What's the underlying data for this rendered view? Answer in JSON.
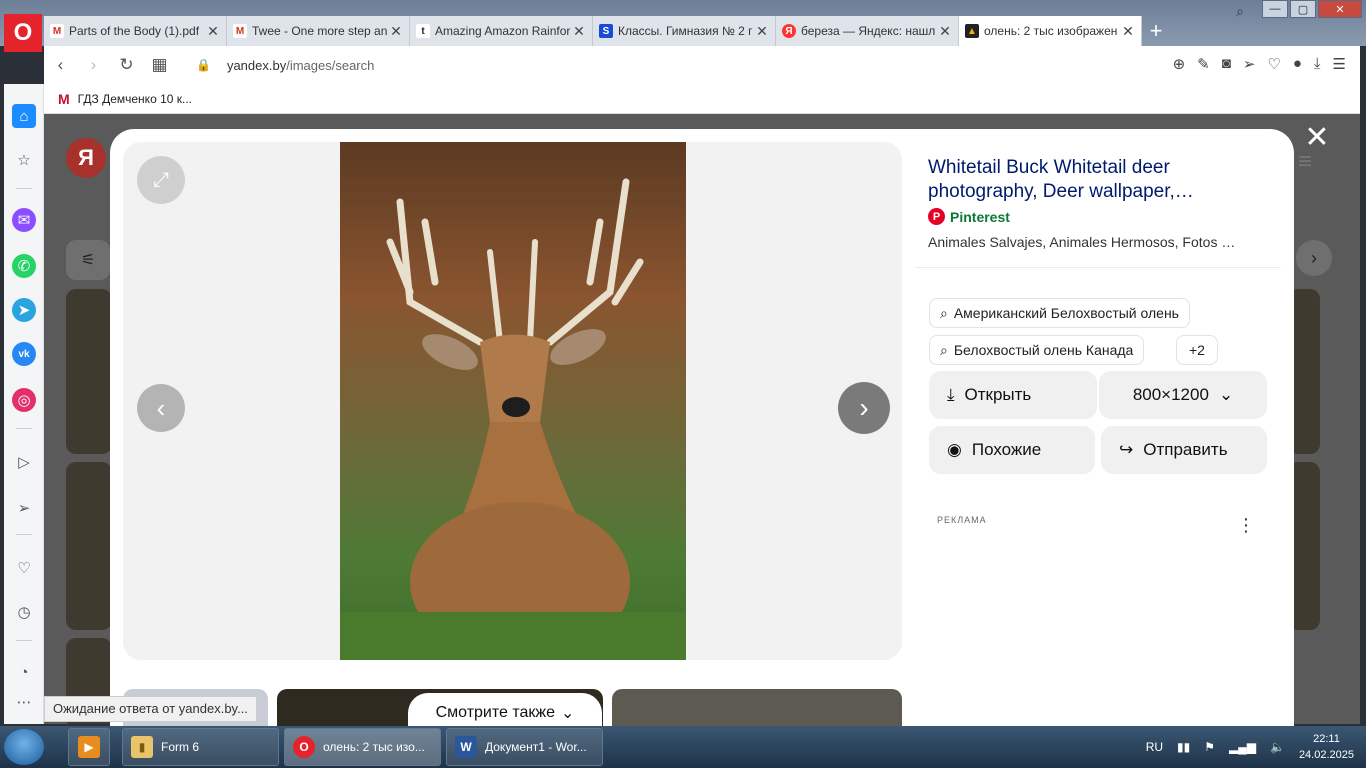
{
  "browser": {
    "tabs": [
      {
        "title": "Parts of the Body (1).pdf",
        "icon": "gmail-icon",
        "color": "#d93025",
        "glyph": "M"
      },
      {
        "title": "Twee - One more step an",
        "icon": "gmail-icon",
        "color": "#d93025",
        "glyph": "M"
      },
      {
        "title": "Amazing Amazon Rainfor",
        "icon": "tumblr-icon",
        "color": "#222222",
        "glyph": "t"
      },
      {
        "title": "Классы. Гимназия № 2 г",
        "icon": "s-icon",
        "color": "#1a4bd6",
        "glyph": "S"
      },
      {
        "title": "береза — Яндекс: нашл",
        "icon": "yandex-icon",
        "color": "#f33",
        "glyph": "Я"
      },
      {
        "title": "олень: 2 тыс изображен",
        "icon": "yandex-images-icon",
        "color": "#f4b400",
        "glyph": "▲"
      }
    ],
    "url_domain": "yandex.by",
    "url_path": "/images/search",
    "bookmark": "ГДЗ Демченко 10 к..."
  },
  "viewer": {
    "title": "Whitetail Buck Whitetail deer photography, Deer wallpaper,…",
    "source": "Pinterest",
    "description": "Animales Salvajes, Animales Hermosos, Fotos …",
    "tags": [
      "Американский Белохвостый олень",
      "Белохвостый олень Канада",
      "+2"
    ],
    "open_label": "Открыть",
    "size_label": "800×1200",
    "similar_label": "Похожие",
    "share_label": "Отправить",
    "see_also_label": "Смотрите также",
    "ad_label": "РЕКЛАМА"
  },
  "status_text": "Ожидание ответа от yandex.by...",
  "taskbar": {
    "items": [
      "Form 6",
      "олень: 2 тыс изо...",
      "Документ1 - Wor..."
    ],
    "lang": "RU",
    "time": "22:11",
    "date": "24.02.2025"
  }
}
